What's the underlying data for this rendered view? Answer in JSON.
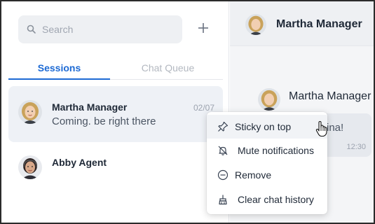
{
  "colors": {
    "accent": "#1d6ad4",
    "sidebar_active_bg": "#eef1f6",
    "chat_bg": "#f4f5f7"
  },
  "search": {
    "placeholder": "Search",
    "icon": "search-icon"
  },
  "add_button": {
    "icon": "plus-icon"
  },
  "tabs": [
    {
      "label": "Sessions",
      "active": true
    },
    {
      "label": "Chat Queue",
      "active": false
    }
  ],
  "conversations": [
    {
      "name": "Martha Manager",
      "preview": "Coming. be right there",
      "date": "02/07",
      "active": true
    },
    {
      "name": "Abby Agent",
      "preview": "",
      "date": "",
      "active": false
    }
  ],
  "chat": {
    "title": "Martha Manager",
    "sender_name": "Martha Manager",
    "bubble_text": "ina!",
    "bubble_time": "12:30"
  },
  "context_menu": {
    "items": [
      {
        "label": "Sticky on top",
        "icon": "pin-icon",
        "hover": true
      },
      {
        "label": "Mute notifications",
        "icon": "bell-off-icon",
        "hover": false
      },
      {
        "label": "Remove",
        "icon": "minus-circle-icon",
        "hover": false
      },
      {
        "label": "Clear chat history",
        "icon": "broom-icon",
        "hover": false
      }
    ]
  }
}
